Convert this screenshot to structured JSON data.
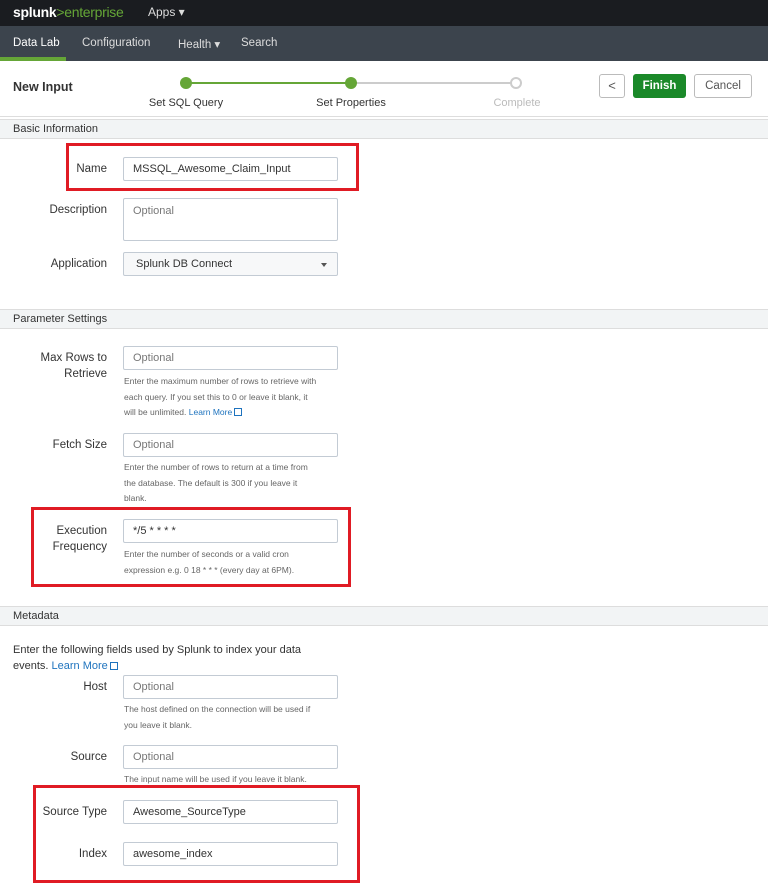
{
  "topbar": {
    "logo_main": "splunk",
    "logo_gt": ">",
    "logo_product": "enterprise",
    "apps_label": "Apps ▾"
  },
  "nav": {
    "items": [
      {
        "label": "Data Lab",
        "active": true
      },
      {
        "label": "Configuration",
        "active": false
      },
      {
        "label": "Health ▾",
        "active": false
      },
      {
        "label": "Search",
        "active": false
      }
    ]
  },
  "wizard": {
    "title": "New Input",
    "steps": [
      {
        "label": "Set SQL Query",
        "state": "done"
      },
      {
        "label": "Set Properties",
        "state": "current"
      },
      {
        "label": "Complete",
        "state": "pending"
      }
    ],
    "back_label": "<",
    "finish_label": "Finish",
    "cancel_label": "Cancel"
  },
  "basic": {
    "header": "Basic Information",
    "name_label": "Name",
    "name_value": "MSSQL_Awesome_Claim_Input",
    "description_label": "Description",
    "description_placeholder": "Optional",
    "application_label": "Application",
    "application_value": "Splunk DB Connect"
  },
  "params": {
    "header": "Parameter Settings",
    "max_rows_label_1": "Max Rows to",
    "max_rows_label_2": "Retrieve",
    "max_rows_placeholder": "Optional",
    "max_rows_help_1": "Enter the maximum number of rows to retrieve with",
    "max_rows_help_2": "each query. If you set this to 0 or leave it blank, it",
    "max_rows_help_3": "will be unlimited.",
    "max_rows_link": "Learn More",
    "fetch_label": "Fetch Size",
    "fetch_placeholder": "Optional",
    "fetch_help_1": "Enter the number of rows to return at a time from",
    "fetch_help_2": "the database. The default is 300 if you leave it",
    "fetch_help_3": "blank.",
    "exec_label_1": "Execution",
    "exec_label_2": "Frequency",
    "exec_value": "*/5 * * * *",
    "exec_help_1": "Enter the number of seconds or a valid cron",
    "exec_help_2": "expression e.g. 0 18 * * * (every day at 6PM)."
  },
  "metadata": {
    "header": "Metadata",
    "intro_1": "Enter the following fields used by Splunk to index your data",
    "intro_2": "events.",
    "intro_link": "Learn More",
    "host_label": "Host",
    "host_placeholder": "Optional",
    "host_help_1": "The host defined on the connection will be used if",
    "host_help_2": "you leave it blank.",
    "source_label": "Source",
    "source_placeholder": "Optional",
    "source_help": "The input name will be used if you leave it blank.",
    "sourcetype_label": "Source Type",
    "sourcetype_value": "Awesome_SourceType",
    "index_label": "Index",
    "index_value": "awesome_index"
  },
  "colors": {
    "accent_green": "#65a637",
    "finish_green": "#1a8929",
    "highlight_red": "#e01b24",
    "link_blue": "#1e73be"
  }
}
